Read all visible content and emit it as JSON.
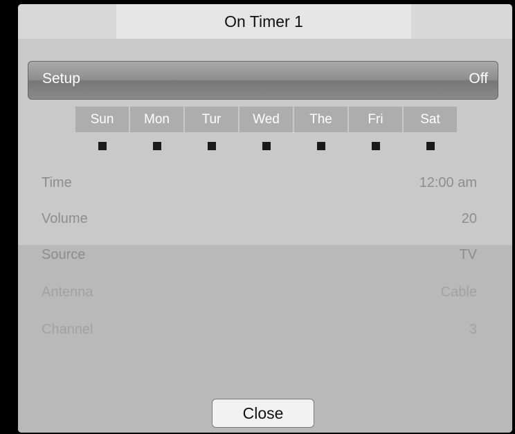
{
  "dialog": {
    "title": "On Timer 1",
    "close_label": "Close"
  },
  "setup": {
    "label": "Setup",
    "value": "Off"
  },
  "days": [
    {
      "label": "Sun"
    },
    {
      "label": "Mon"
    },
    {
      "label": "Tur"
    },
    {
      "label": "Wed"
    },
    {
      "label": "The"
    },
    {
      "label": "Fri"
    },
    {
      "label": "Sat"
    }
  ],
  "settings": {
    "time": {
      "label": "Time",
      "value": "12:00 am"
    },
    "volume": {
      "label": "Volume",
      "value": "20"
    },
    "source": {
      "label": "Source",
      "value": "TV"
    },
    "antenna": {
      "label": "Antenna",
      "value": "Cable"
    },
    "channel": {
      "label": "Channel",
      "value": "3"
    }
  }
}
